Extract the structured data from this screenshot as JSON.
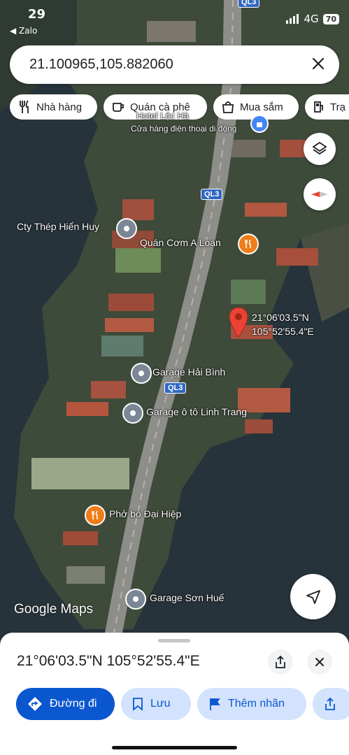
{
  "status": {
    "time": "29",
    "back_app": "◀ Zalo",
    "network": "4G",
    "battery": "70"
  },
  "search": {
    "value": "21.100965,105.882060"
  },
  "chips": [
    {
      "label": "Nhà hàng",
      "icon": "restaurant-icon"
    },
    {
      "label": "Quán cà phê",
      "icon": "coffee-icon"
    },
    {
      "label": "Mua sắm",
      "icon": "shopping-icon"
    },
    {
      "label": "Trạ",
      "icon": "gas-station-icon"
    }
  ],
  "map": {
    "pin_coords": [
      "21°06'03.5\"N",
      "105°52'55.4\"E"
    ],
    "places": [
      {
        "name": "Cty Thép Hiển Huy",
        "icon": "place-icon"
      },
      {
        "name": "Quán Cơm A Loan",
        "icon": "restaurant-icon"
      },
      {
        "name": "Garage Hải Bình",
        "icon": "place-icon"
      },
      {
        "name": "Garage ô tô Linh Trang",
        "icon": "place-icon"
      },
      {
        "name": "Phở bò Đại Hiệp",
        "icon": "restaurant-icon"
      },
      {
        "name": "Garage Sơn Huế",
        "icon": "place-icon"
      },
      {
        "name": "Cửa hàng điện thoại di động",
        "icon": "shopping-icon"
      },
      {
        "name": "Hotel Lộc Hà",
        "icon": "hotel-icon"
      }
    ],
    "road_labels": [
      "QL3",
      "QL3",
      "QL3"
    ],
    "logo": "Google Maps"
  },
  "sheet": {
    "title": "21°06'03.5\"N 105°52'55.4\"E",
    "actions": [
      {
        "label": "Đường đi",
        "icon": "directions-icon"
      },
      {
        "label": "Lưu",
        "icon": "bookmark-icon"
      },
      {
        "label": "Thêm nhãn",
        "icon": "flag-icon"
      },
      {
        "label": "",
        "icon": "share-icon"
      }
    ]
  },
  "colors": {
    "accent": "#0b57d0",
    "pin": "#ea4335",
    "poi_orange": "#f07c1a",
    "poi_gray": "#7b8794",
    "water": "#243038"
  }
}
